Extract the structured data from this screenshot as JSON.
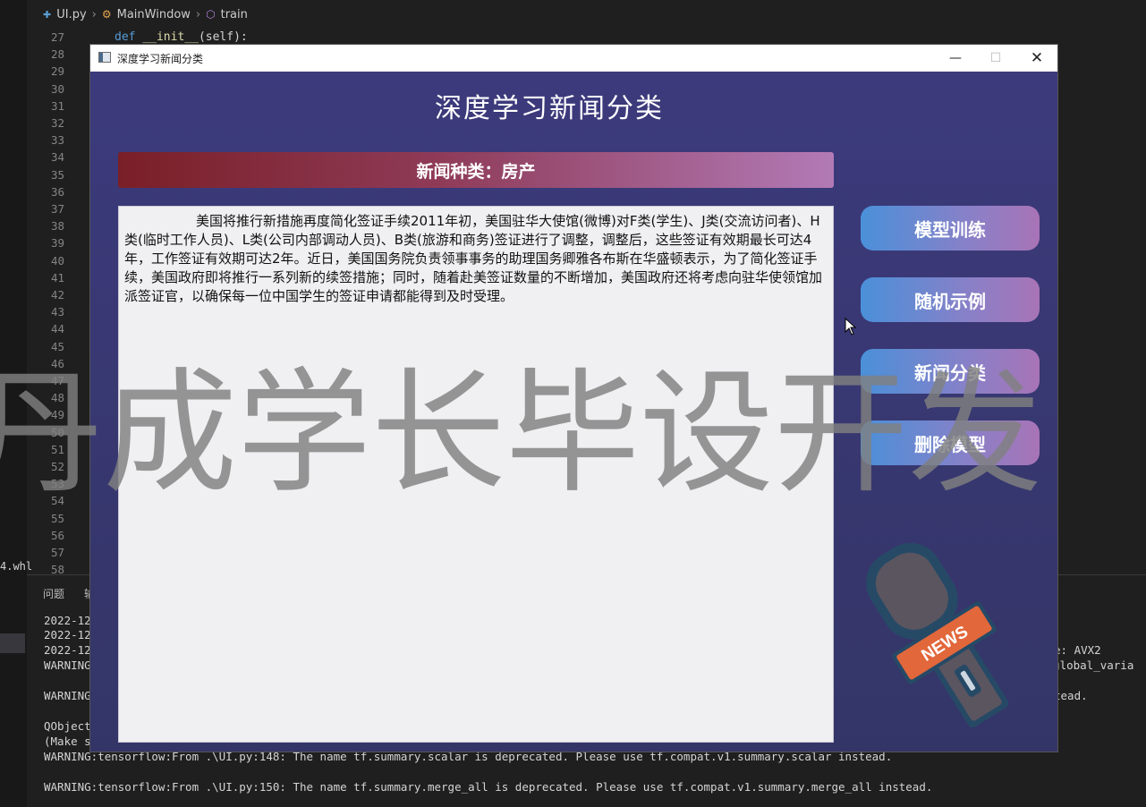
{
  "ide": {
    "breadcrumb": {
      "file": "UI.py",
      "class": "MainWindow",
      "method": "train"
    },
    "line_numbers": [
      "27",
      "28",
      "29",
      "30",
      "31",
      "32",
      "33",
      "34",
      "35",
      "36",
      "37",
      "38",
      "39",
      "40",
      "41",
      "42",
      "43",
      "44",
      "45",
      "46",
      "47",
      "48",
      "49",
      "50",
      "51",
      "52",
      "53",
      "54",
      "55",
      "56",
      "57",
      "58"
    ],
    "code_line_27": {
      "keyword": "def",
      "name": "__init__",
      "rest": "(self):"
    },
    "tool_window_label": "4.whl",
    "panel_tabs": [
      "问题",
      "输"
    ],
    "output_lines": [
      "2022-12-",
      "2022-12-",
      "2022-12-",
      "WARNING:",
      "",
      "WARNING:",
      "",
      "QObject:",
      "(Make su",
      "WARNING:tensorflow:From .\\UI.py:148: The name tf.summary.scalar is deprecated. Please use tf.compat.v1.summary.scalar instead.",
      "",
      "WARNING:tensorflow:From .\\UI.py:150: The name tf.summary.merge_all is deprecated. Please use tf.compat.v1.summary.merge_all instead."
    ],
    "output_right": [
      "e: AVX2",
      "1.global_varia",
      "tead."
    ]
  },
  "window": {
    "title": "深度学习新闻分类",
    "heading": "深度学习新闻分类",
    "category_label": "新闻种类：房产",
    "news_text": "美国将推行新措施再度简化签证手续2011年初，美国驻华大使馆(微博)对F类(学生)、J类(交流访问者)、H类(临时工作人员)、L类(公司内部调动人员)、B类(旅游和商务)签证进行了调整，调整后，这些签证有效期最长可达4年，工作签证有效期可达2年。近日，美国国务院负责领事事务的助理国务卿雅各布斯在华盛顿表示，为了简化签证手续，美国政府即将推行一系列新的续签措施；同时，随着赴美签证数量的不断增加，美国政府还将考虑向驻华使领馆加派签证官，以确保每一位中国学生的签证申请都能得到及时受理。",
    "buttons": {
      "train": "模型训练",
      "random": "随机示例",
      "classify": "新闻分类",
      "delete": "删除模型"
    },
    "mic_label": "NEWS"
  },
  "watermark": "丹成学长毕设开发",
  "colors": {
    "window_bg": "#3a3a73",
    "category_start": "#7a1f27",
    "category_end": "#b27ab6",
    "button_start": "#4a90d9",
    "button_end": "#a874b6",
    "mic_tag": "#e2673b"
  }
}
